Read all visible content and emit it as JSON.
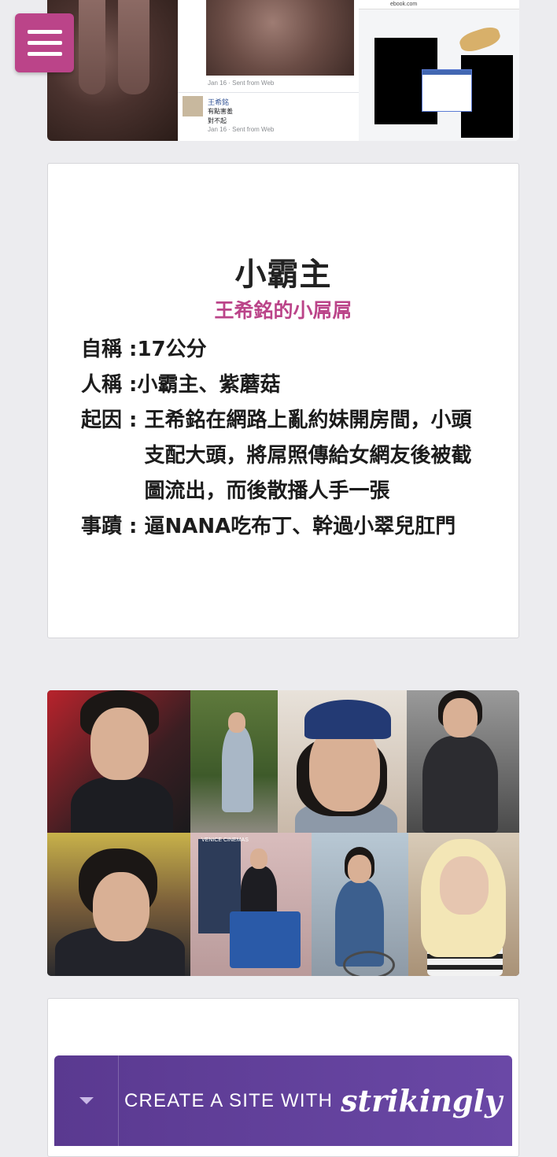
{
  "top_screenshot": {
    "timestamp_1": "Jan 16 · Sent from Web",
    "commenter_name": "王希銘",
    "comment_line_1": "有點害羞",
    "comment_line_2": "對不起",
    "timestamp_2": "Jan 16 · Sent from Web",
    "browser_url": "ebook.com"
  },
  "card": {
    "title": "小霸主",
    "subtitle": "王希銘的小屌屌",
    "rows": [
      {
        "label": "自稱 :",
        "value": "17公分"
      },
      {
        "label": "人稱 :",
        "value": "小霸主、紫蘑菇"
      },
      {
        "label": "起因 : ",
        "value": "王希銘在網路上亂約妹開房間，小頭支配大頭，將屌照傳給女網友後被截圖流出，而後散播人手一張"
      },
      {
        "label": "事蹟 : ",
        "value": "逼NANA吃布丁、幹過小翠兒肛門"
      }
    ]
  },
  "collage": {
    "sign_text": "VENICE CINEMAS"
  },
  "banner": {
    "cta": "CREATE A SITE WITH",
    "brand": "strikingly"
  },
  "colors": {
    "accent": "#bb4489",
    "banner": "#5a3990",
    "background": "#ececef"
  }
}
